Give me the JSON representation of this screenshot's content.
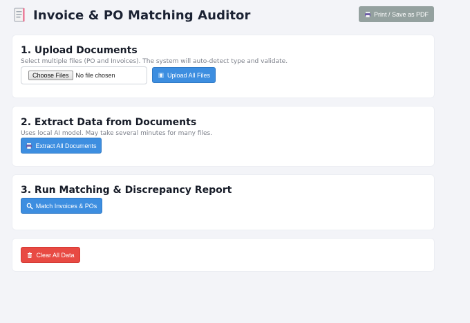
{
  "header": {
    "title": "Invoice & PO Matching Auditor",
    "print_label": "Print / Save as PDF"
  },
  "upload": {
    "title": "1. Upload Documents",
    "hint": "Select multiple files (PO and Invoices). The system will auto-detect type and validate.",
    "choose_files_label": "Choose Files",
    "no_file_text": "No file chosen",
    "upload_button": "Upload All Files"
  },
  "extract": {
    "title": "2. Extract Data from Documents",
    "hint": "Uses local AI model. May take several minutes for many files.",
    "button": "Extract All Documents"
  },
  "match": {
    "title": "3. Run Matching & Discrepancy Report",
    "button": "Match Invoices & POs"
  },
  "clear": {
    "button": "Clear All Data"
  },
  "colors": {
    "background": "#f3f4f8",
    "primary": "#3d8ee0",
    "danger": "#e84a43",
    "print_button": "#94a19f"
  },
  "icons": {
    "title": "document-icon",
    "print": "printer-icon",
    "upload": "upload-arrow-icon",
    "extract": "printer-icon",
    "match": "magnifier-icon",
    "clear": "trash-icon"
  }
}
